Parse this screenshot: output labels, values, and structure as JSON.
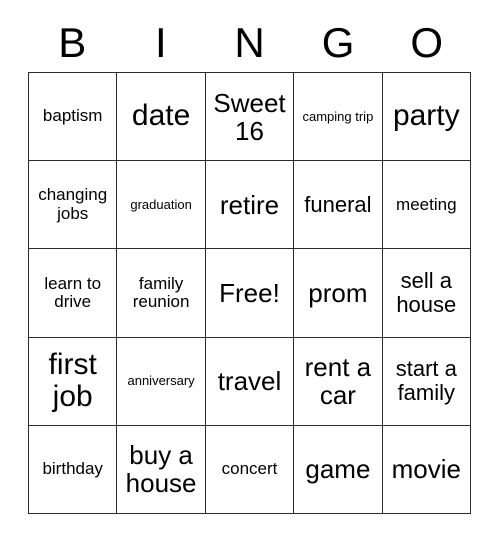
{
  "card": {
    "header": {
      "letters": [
        "B",
        "I",
        "N",
        "G",
        "O"
      ]
    },
    "colors": {
      "border": "#2b2b2b",
      "text": "#000000",
      "background": "#ffffff"
    },
    "grid": {
      "rows": 5,
      "columns": 5,
      "cells": [
        [
          {
            "label": "baptism",
            "size": "fs-sm"
          },
          {
            "label": "date",
            "size": "fs-xl"
          },
          {
            "label": "Sweet 16",
            "size": "fs-lg"
          },
          {
            "label": "camping trip",
            "size": "fs-xs"
          },
          {
            "label": "party",
            "size": "fs-xl"
          }
        ],
        [
          {
            "label": "changing jobs",
            "size": "fs-sm"
          },
          {
            "label": "graduation",
            "size": "fs-xs"
          },
          {
            "label": "retire",
            "size": "fs-lg"
          },
          {
            "label": "funeral",
            "size": "fs-md"
          },
          {
            "label": "meeting",
            "size": "fs-sm"
          }
        ],
        [
          {
            "label": "learn to drive",
            "size": "fs-sm"
          },
          {
            "label": "family reunion",
            "size": "fs-sm"
          },
          {
            "label": "Free!",
            "size": "fs-lg"
          },
          {
            "label": "prom",
            "size": "fs-lg"
          },
          {
            "label": "sell a house",
            "size": "fs-md"
          }
        ],
        [
          {
            "label": "first job",
            "size": "fs-xl"
          },
          {
            "label": "anniversary",
            "size": "fs-xs"
          },
          {
            "label": "travel",
            "size": "fs-lg"
          },
          {
            "label": "rent a car",
            "size": "fs-lg"
          },
          {
            "label": "start a family",
            "size": "fs-md"
          }
        ],
        [
          {
            "label": "birthday",
            "size": "fs-sm"
          },
          {
            "label": "buy a house",
            "size": "fs-lg"
          },
          {
            "label": "concert",
            "size": "fs-sm"
          },
          {
            "label": "game",
            "size": "fs-lg"
          },
          {
            "label": "movie",
            "size": "fs-lg"
          }
        ]
      ]
    }
  }
}
